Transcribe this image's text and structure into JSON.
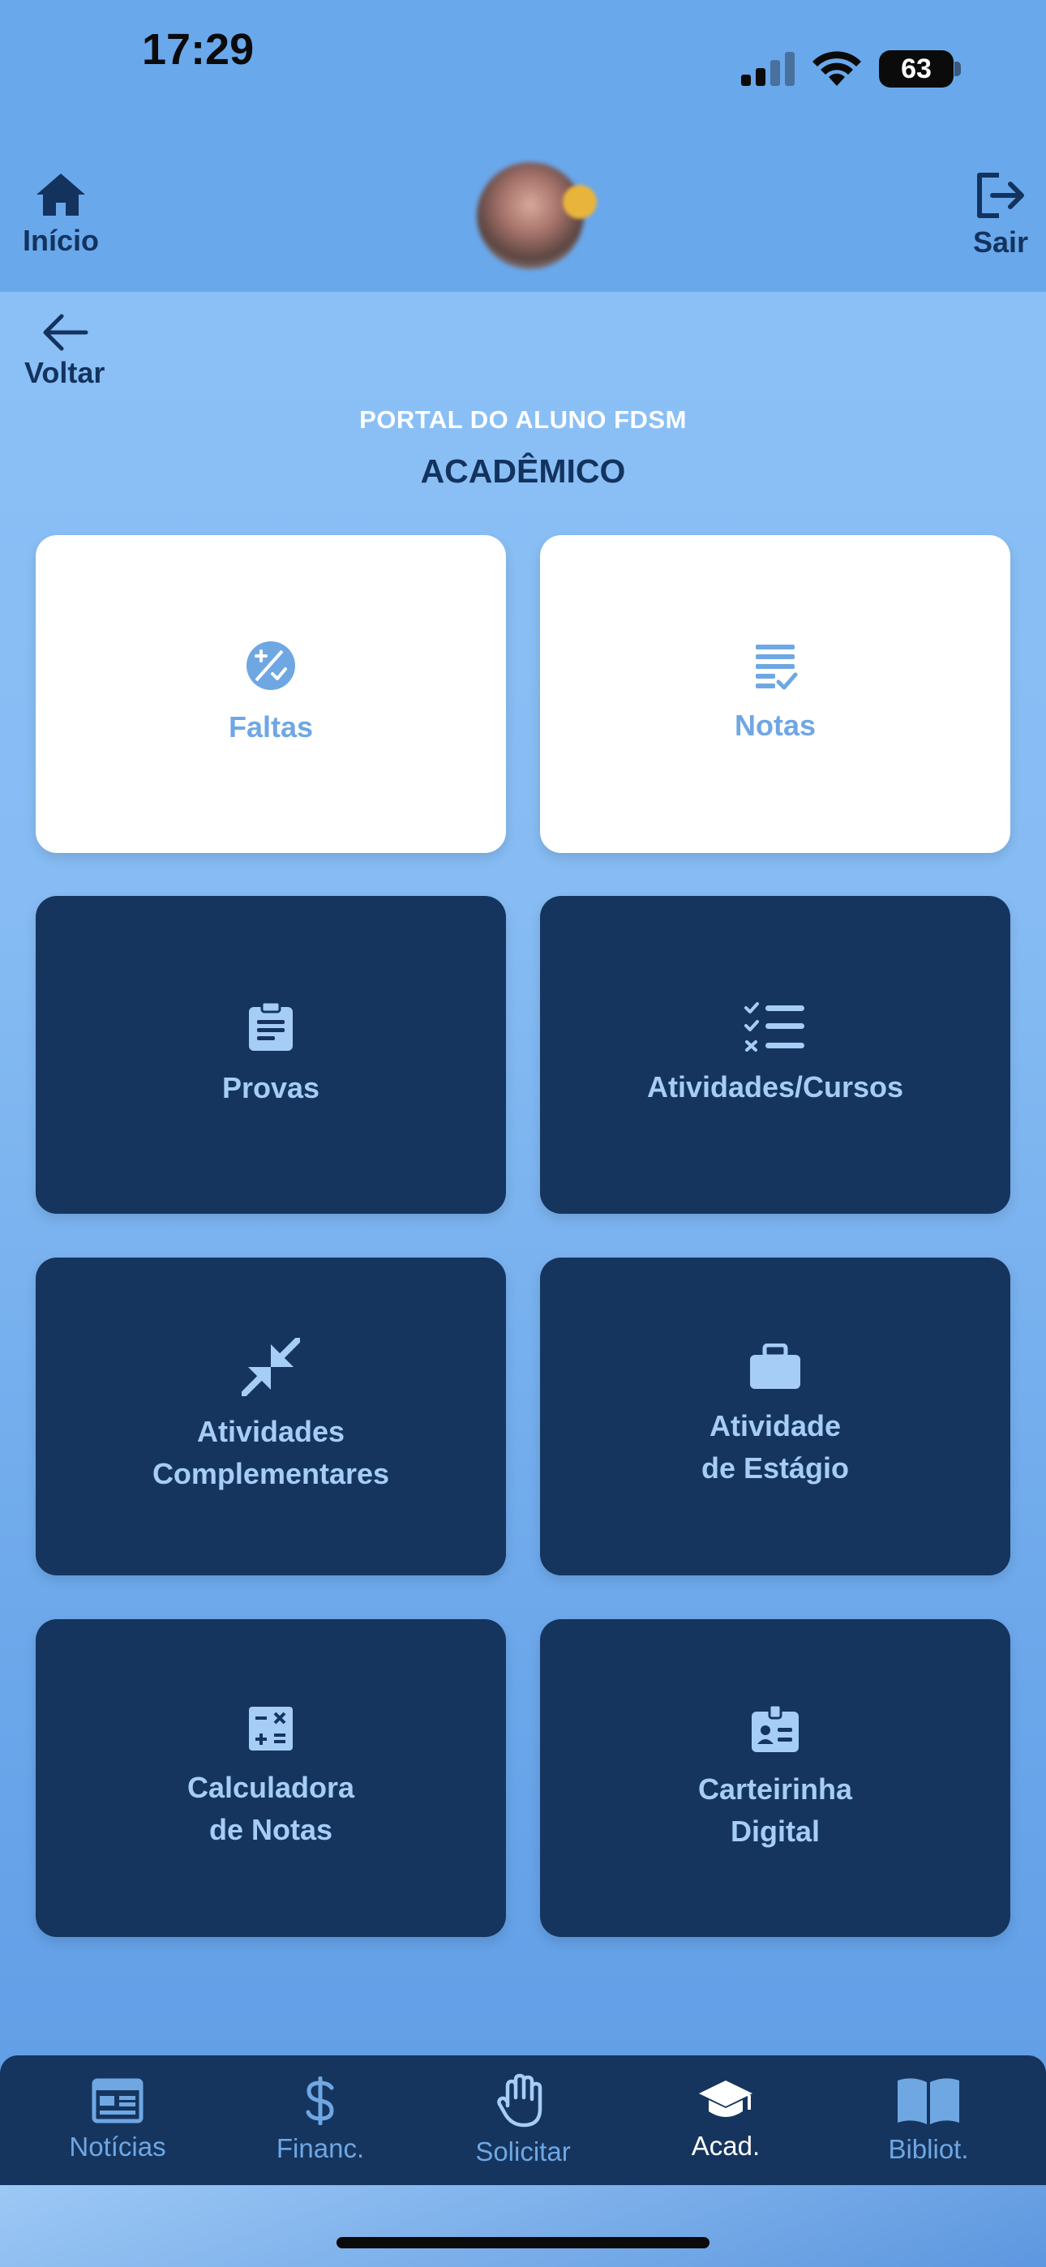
{
  "status_bar": {
    "time": "17:29",
    "battery": "63"
  },
  "top_nav": {
    "home_label": "Início",
    "logout_label": "Sair"
  },
  "back": {
    "label": "Voltar"
  },
  "header": {
    "portal": "PORTAL DO ALUNO FDSM",
    "section": "ACADÊMICO"
  },
  "cards": [
    {
      "label": "Faltas",
      "icon": "percent-badge-icon"
    },
    {
      "label": "Notas",
      "icon": "grade-list-icon"
    },
    {
      "label": "Provas",
      "icon": "clipboard-icon"
    },
    {
      "label": "Atividades/Cursos",
      "icon": "checklist-icon"
    },
    {
      "label": "Atividades\nComplementares",
      "icon": "arrows-inward-icon"
    },
    {
      "label": "Atividade\nde Estágio",
      "icon": "briefcase-icon"
    },
    {
      "label": "Calculadora\nde Notas",
      "icon": "calculator-icon"
    },
    {
      "label": "Carteirinha\nDigital",
      "icon": "id-badge-icon"
    }
  ],
  "bottom_nav": [
    {
      "label": "Notícias",
      "icon": "newspaper-icon"
    },
    {
      "label": "Financ.",
      "icon": "dollar-icon"
    },
    {
      "label": "Solicitar",
      "icon": "hand-icon"
    },
    {
      "label": "Acad.",
      "icon": "graduation-cap-icon",
      "active": true
    },
    {
      "label": "Bibliot.",
      "icon": "book-icon"
    }
  ],
  "colors": {
    "accent": "#6fa7e3",
    "dark_card": "#15355f",
    "nav_bg": "#6aa8ec"
  }
}
